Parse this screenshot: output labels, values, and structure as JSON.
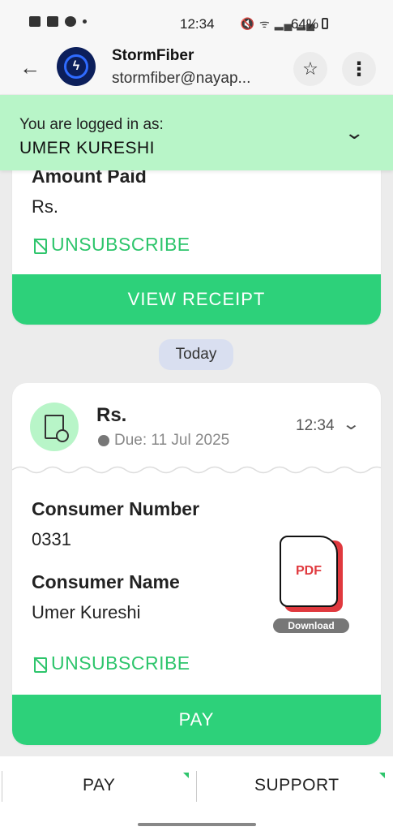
{
  "status_bar": {
    "time": "12:34",
    "battery": "64%"
  },
  "header": {
    "name": "StormFiber",
    "email": "stormfiber@nayap..."
  },
  "banner": {
    "label": "You are logged in as:",
    "user": "UMER KURESHI"
  },
  "card1": {
    "amount_label": "Amount Paid",
    "amount_value": "Rs.",
    "unsubscribe": "UNSUBSCRIBE",
    "button": "VIEW RECEIPT"
  },
  "today_label": "Today",
  "card2": {
    "amount": "Rs.",
    "due": "Due: 11 Jul 2025",
    "time": "12:34",
    "consumer_number_label": "Consumer Number",
    "consumer_number": "0331",
    "consumer_name_label": "Consumer Name",
    "consumer_name": "Umer Kureshi",
    "pdf_label": "PDF",
    "download_label": "Download",
    "unsubscribe": "UNSUBSCRIBE",
    "button": "PAY"
  },
  "bottom_bar": {
    "pay": "PAY",
    "support": "SUPPORT"
  },
  "colors": {
    "accent_green": "#2dd17a",
    "banner_bg": "#b8f5c8",
    "pdf_red": "#e0393e"
  }
}
